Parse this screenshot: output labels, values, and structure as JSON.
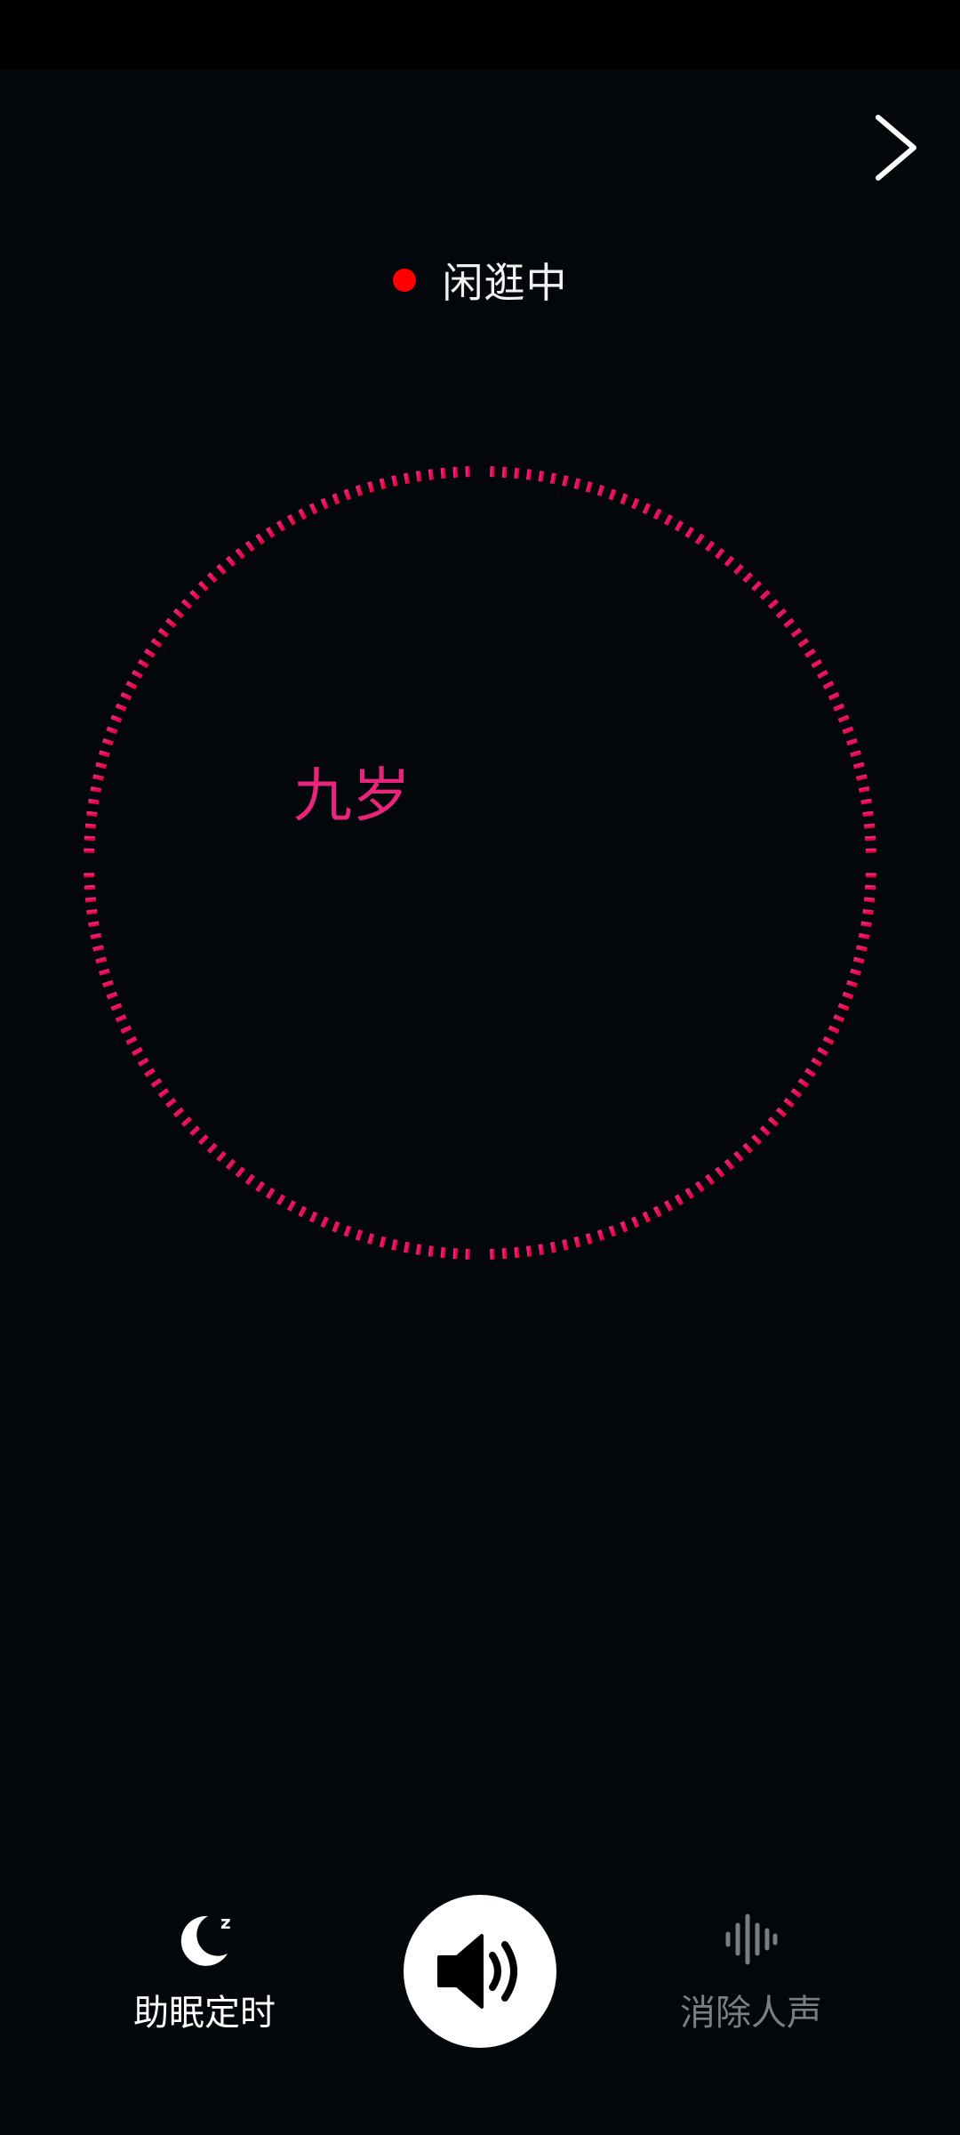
{
  "status": {
    "text": "闲逛中",
    "dot_color": "#ff0000"
  },
  "now_playing": {
    "title": "九岁",
    "title_color": "#e8257a"
  },
  "visualizer": {
    "ring_colors": [
      "#e8257a",
      "#e8003a"
    ]
  },
  "nav": {
    "next_icon": "chevron-right-icon"
  },
  "controls": {
    "sleep_timer": {
      "label": "助眠定时",
      "icon": "moon-sleep-icon",
      "color": "#ffffff"
    },
    "volume": {
      "icon": "speaker-volume-icon"
    },
    "remove_vocals": {
      "label": "消除人声",
      "icon": "sound-wave-icon",
      "color": "#7a7d82"
    }
  }
}
